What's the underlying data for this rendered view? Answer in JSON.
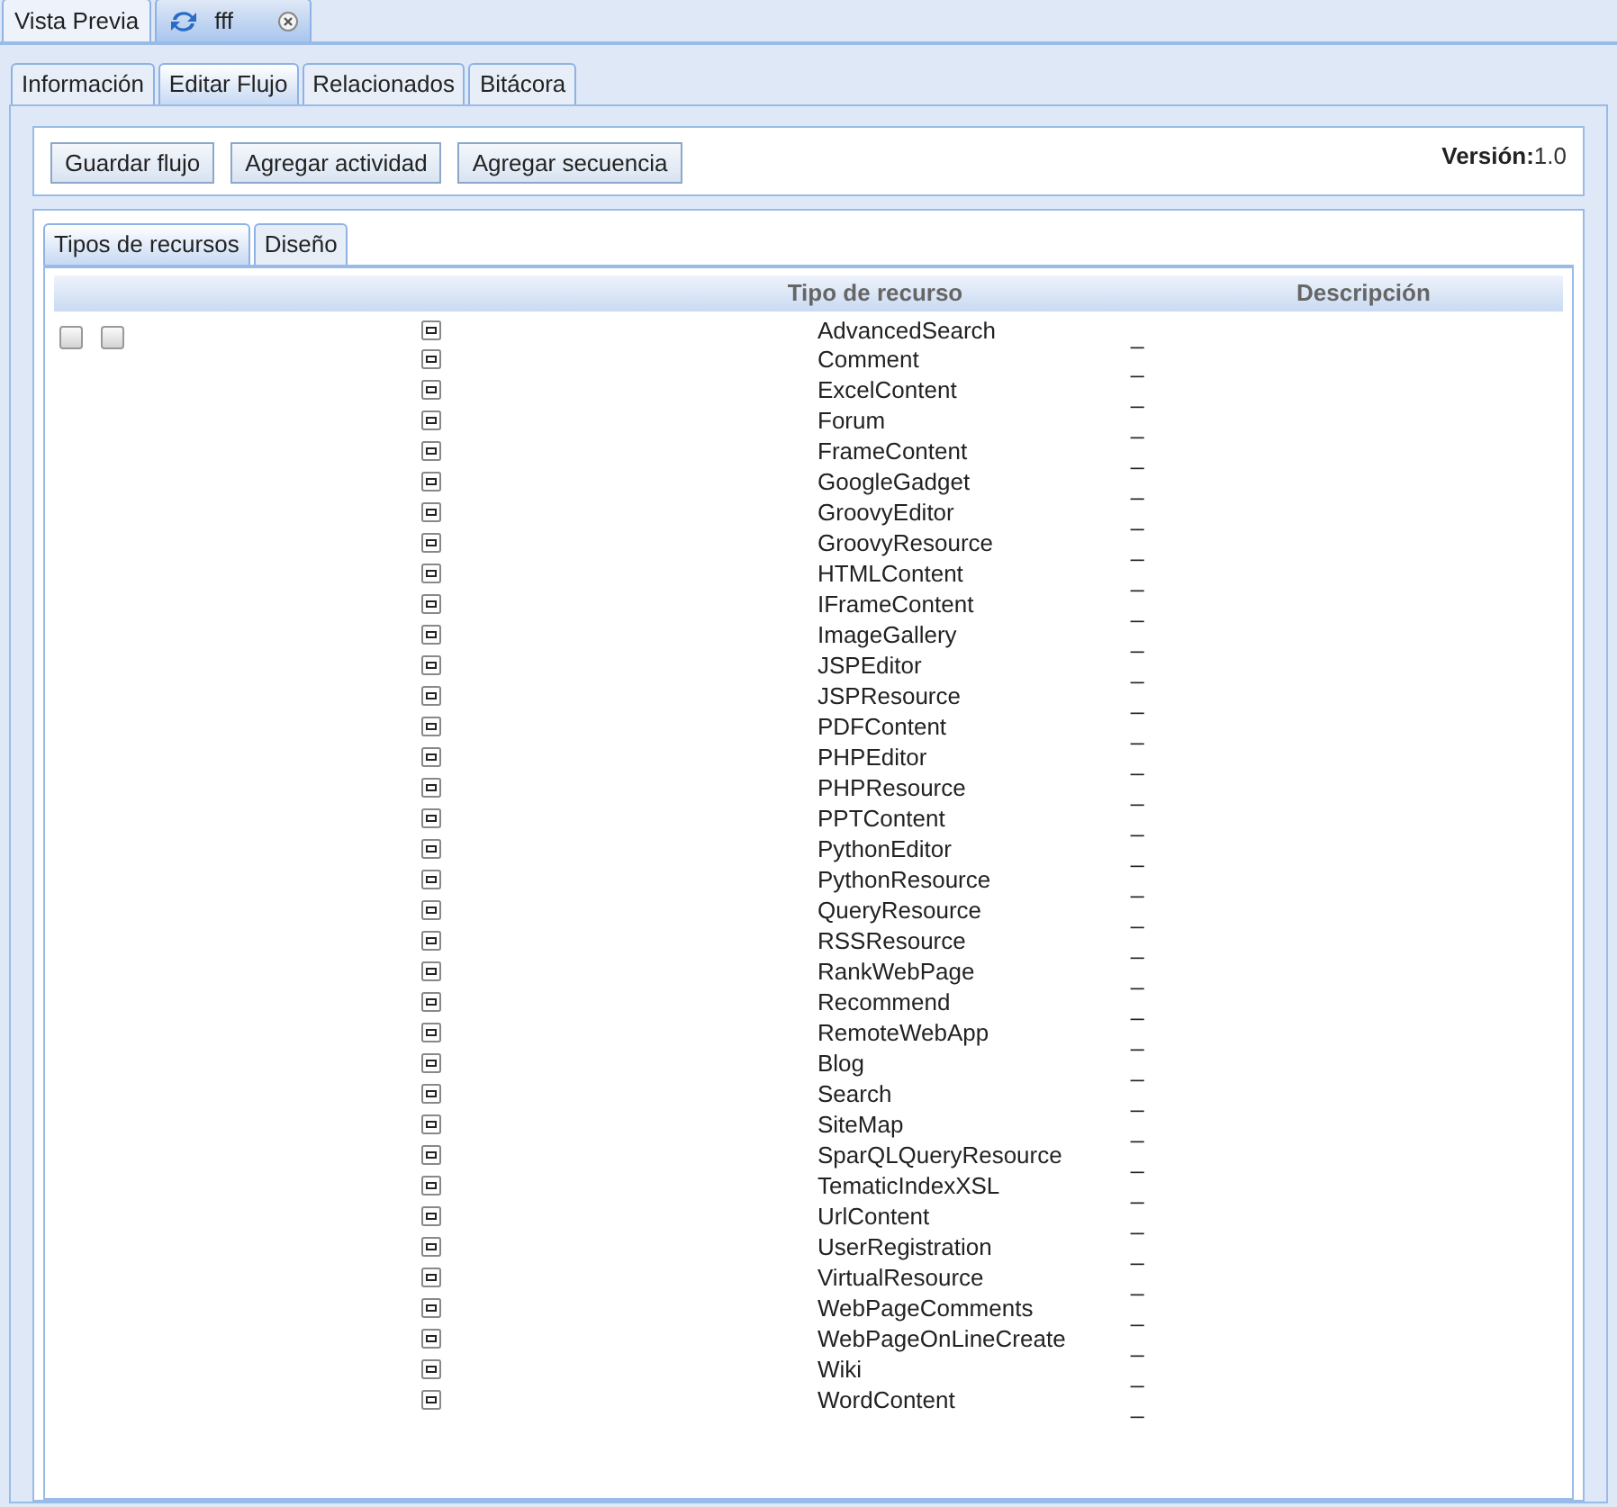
{
  "top_tabs": [
    {
      "label": "Vista Previa",
      "selected": false,
      "closable": false,
      "refresh": false
    },
    {
      "label": "fff",
      "selected": true,
      "closable": true,
      "refresh": true
    }
  ],
  "section_tabs": [
    {
      "label": "Información",
      "selected": false
    },
    {
      "label": "Editar Flujo",
      "selected": true
    },
    {
      "label": "Relacionados",
      "selected": false
    },
    {
      "label": "Bitácora",
      "selected": false
    }
  ],
  "toolbar": {
    "buttons": [
      "Guardar flujo",
      "Agregar actividad",
      "Agregar secuencia"
    ],
    "version_label": "Versión:",
    "version_value": "1.0"
  },
  "resource_tabs": [
    {
      "label": "Tipos de recursos",
      "selected": true
    },
    {
      "label": "Diseño",
      "selected": false
    }
  ],
  "grid": {
    "columns": [
      "Tipo de recurso",
      "Descripción"
    ],
    "header_checkboxes": [
      {
        "checked": false
      },
      {
        "checked": false
      }
    ],
    "rows": [
      {
        "name": "AdvancedSearch",
        "description": "_"
      },
      {
        "name": "Comment",
        "description": "_"
      },
      {
        "name": "ExcelContent",
        "description": "_"
      },
      {
        "name": "Forum",
        "description": "_"
      },
      {
        "name": "FrameContent",
        "description": "_"
      },
      {
        "name": "GoogleGadget",
        "description": "_"
      },
      {
        "name": "GroovyEditor",
        "description": "_"
      },
      {
        "name": "GroovyResource",
        "description": "_"
      },
      {
        "name": "HTMLContent",
        "description": "_"
      },
      {
        "name": "IFrameContent",
        "description": "_"
      },
      {
        "name": "ImageGallery",
        "description": "_"
      },
      {
        "name": "JSPEditor",
        "description": "_"
      },
      {
        "name": "JSPResource",
        "description": "_"
      },
      {
        "name": "PDFContent",
        "description": "_"
      },
      {
        "name": "PHPEditor",
        "description": "_"
      },
      {
        "name": "PHPResource",
        "description": "_"
      },
      {
        "name": "PPTContent",
        "description": "_"
      },
      {
        "name": "PythonEditor",
        "description": "_"
      },
      {
        "name": "PythonResource",
        "description": "_"
      },
      {
        "name": "QueryResource",
        "description": "_"
      },
      {
        "name": "RSSResource",
        "description": "_"
      },
      {
        "name": "RankWebPage",
        "description": "_"
      },
      {
        "name": "Recommend",
        "description": "_"
      },
      {
        "name": "RemoteWebApp",
        "description": "_"
      },
      {
        "name": "Blog",
        "description": "_"
      },
      {
        "name": "Search",
        "description": "_"
      },
      {
        "name": "SiteMap",
        "description": "_"
      },
      {
        "name": "SparQLQueryResource",
        "description": "_"
      },
      {
        "name": "TematicIndexXSL",
        "description": "_"
      },
      {
        "name": "UrlContent",
        "description": "_"
      },
      {
        "name": "UserRegistration",
        "description": "_"
      },
      {
        "name": "VirtualResource",
        "description": "_"
      },
      {
        "name": "WebPageComments",
        "description": "_"
      },
      {
        "name": "WebPageOnLineCreate",
        "description": "_"
      },
      {
        "name": "Wiki",
        "description": "_"
      },
      {
        "name": "WordContent",
        "description": "_"
      }
    ]
  }
}
